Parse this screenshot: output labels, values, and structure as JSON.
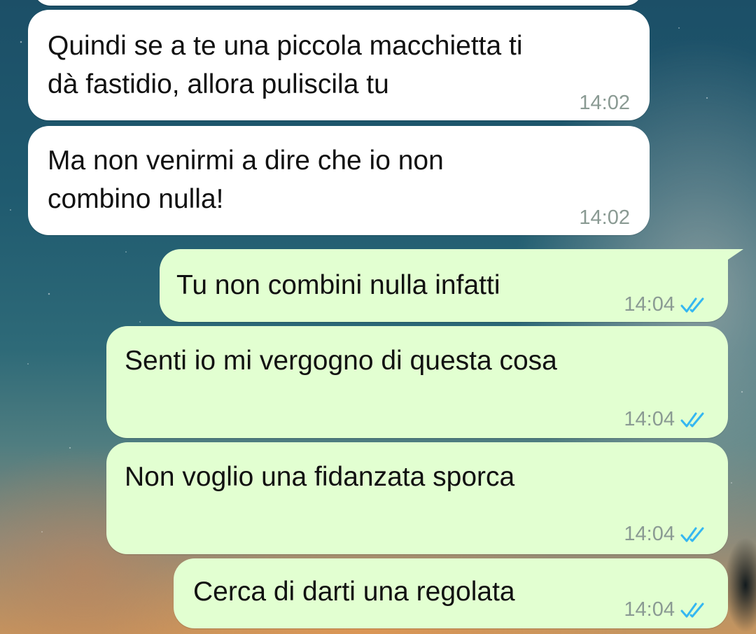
{
  "chat": {
    "messages": [
      {
        "text": "Quindi se a te una piccola macchietta ti\ndà fastidio, allora puliscila tu",
        "time": "14:02",
        "direction": "incoming"
      },
      {
        "text": "Ma non venirmi a dire che io non\ncombino nulla!",
        "time": "14:02",
        "direction": "incoming"
      },
      {
        "text": "Tu non combini nulla infatti",
        "time": "14:04",
        "direction": "outgoing",
        "status": "read-ticks-icon"
      },
      {
        "text": "Senti io mi vergogno di questa cosa",
        "time": "14:04",
        "direction": "outgoing",
        "status": "read-ticks-icon"
      },
      {
        "text": "Non voglio una fidanzata sporca",
        "time": "14:04",
        "direction": "outgoing",
        "status": "read-ticks-icon"
      },
      {
        "text": "Cerca di darti una regolata",
        "time": "14:04",
        "direction": "outgoing",
        "status": "read-ticks-icon"
      }
    ]
  },
  "colors": {
    "incoming_bubble": "#ffffff",
    "outgoing_bubble": "#e2ffd1",
    "read_ticks": "#34b7f1",
    "timestamp": "#8a9a93"
  }
}
